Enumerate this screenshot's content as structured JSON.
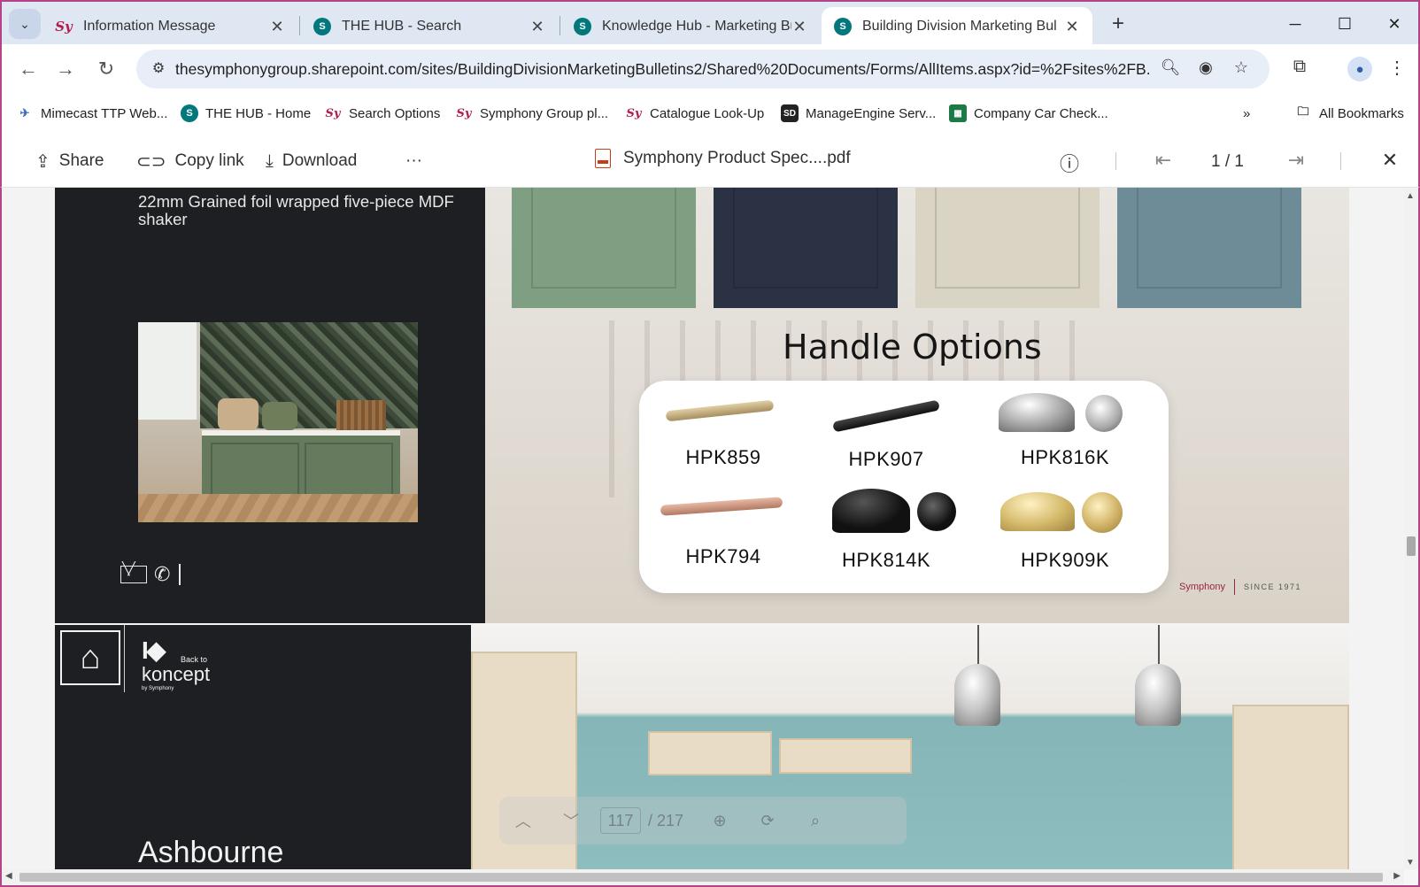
{
  "browser": {
    "tabs": [
      {
        "title": "Information Message",
        "favicon": "sy-logo-icon",
        "active": false
      },
      {
        "title": "THE HUB - Search",
        "favicon": "sharepoint-icon",
        "active": false
      },
      {
        "title": "Knowledge Hub - Marketing Bu",
        "favicon": "sharepoint-icon",
        "active": false
      },
      {
        "title": "Building Division Marketing Bul",
        "favicon": "sharepoint-icon",
        "active": true
      }
    ],
    "url": "thesymphonygroup.sharepoint.com/sites/BuildingDivisionMarketingBulletins2/Shared%20Documents/Forms/AllItems.aspx?id=%2Fsites%2FB...",
    "bookmarks": [
      {
        "label": "Mimecast TTP Web...",
        "icon": "mimecast-icon"
      },
      {
        "label": "THE HUB - Home",
        "icon": "sharepoint-icon"
      },
      {
        "label": "Search Options",
        "icon": "sy-logo-icon"
      },
      {
        "label": "Symphony Group pl...",
        "icon": "sy-logo-icon"
      },
      {
        "label": "Catalogue Look-Up",
        "icon": "sy-logo-icon"
      },
      {
        "label": "ManageEngine Serv...",
        "icon": "servicedesk-icon"
      },
      {
        "label": "Company Car Check...",
        "icon": "excel-icon"
      }
    ],
    "bookmark_sd_badge": "SD",
    "all_bookmarks": "All Bookmarks"
  },
  "viewer": {
    "share": "Share",
    "copy_link": "Copy link",
    "download": "Download",
    "more": "···",
    "doc_title": "Symphony Product Spec....pdf",
    "page_indicator": "1 / 1"
  },
  "page1": {
    "description": "22mm Grained foil wrapped five-piece MDF shaker",
    "door_colors": [
      "#7f9f82",
      "#2a3244",
      "#d9d4c3",
      "#6e8c98"
    ],
    "heading": "Handle Options",
    "handles": [
      {
        "code": "HPK859",
        "finish": "brushed-brass-bar"
      },
      {
        "code": "HPK907",
        "finish": "matt-black-bar"
      },
      {
        "code": "HPK816K",
        "finish": "chrome-cup-knob"
      },
      {
        "code": "HPK794",
        "finish": "copper-bar"
      },
      {
        "code": "HPK814K",
        "finish": "black-cup-knob"
      },
      {
        "code": "HPK909K",
        "finish": "brass-cup-knob"
      }
    ],
    "brand": "Symphony",
    "since": "SINCE 1971"
  },
  "page2": {
    "back_to": "Back to",
    "koncept": "koncept",
    "by_symphony": "by Symphony",
    "cut_title": "Ashbourne"
  },
  "pdf_toolbar": {
    "page_input": "117",
    "page_total": "/ 217"
  }
}
